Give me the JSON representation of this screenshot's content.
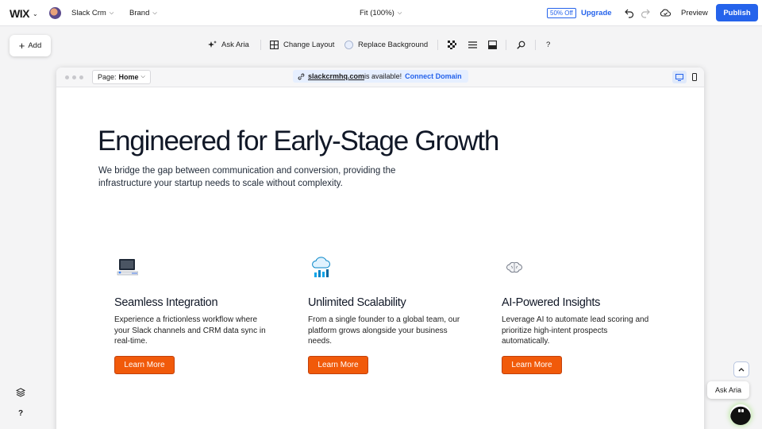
{
  "topbar": {
    "logo": "WIX",
    "site_name": "Slack Crm",
    "brand_label": "Brand",
    "zoom_label": "Fit (100%)",
    "offer_badge": "50% Off",
    "upgrade_label": "Upgrade",
    "preview_label": "Preview",
    "publish_label": "Publish"
  },
  "toolbar": {
    "add_label": "Add",
    "ask_aria_label": "Ask Aria",
    "change_layout_label": "Change Layout",
    "replace_background_label": "Replace Background",
    "help_label": "?"
  },
  "frame": {
    "page_prefix": "Page:",
    "page_name": "Home",
    "domain": "slackcrmhq.com",
    "domain_status": "is available!",
    "connect_label": "Connect Domain"
  },
  "hero": {
    "title": "Engineered for Early-Stage Growth",
    "subtitle": "We bridge the gap between communication and conversion, providing the infrastructure your startup needs to scale without complexity."
  },
  "features": [
    {
      "icon": "computer-integration-icon",
      "title": "Seamless Integration",
      "description": "Experience a frictionless workflow where your Slack channels and CRM data sync in real-time.",
      "button": "Learn More"
    },
    {
      "icon": "cloud-growth-icon",
      "title": "Unlimited Scalability",
      "description": "From a single founder to a global team, our platform grows alongside your business needs.",
      "button": "Learn More"
    },
    {
      "icon": "brain-icon",
      "title": "AI-Powered Insights",
      "description": "Leverage AI to automate lead scoring and prioritize high-intent prospects automatically.",
      "button": "Learn More"
    }
  ],
  "floating": {
    "ask_aria_label": "Ask Aria",
    "help_label": "?"
  },
  "colors": {
    "accent_blue": "#2563eb",
    "cta_orange": "#f15a0a",
    "canvas_bg": "#f4f4f5"
  }
}
